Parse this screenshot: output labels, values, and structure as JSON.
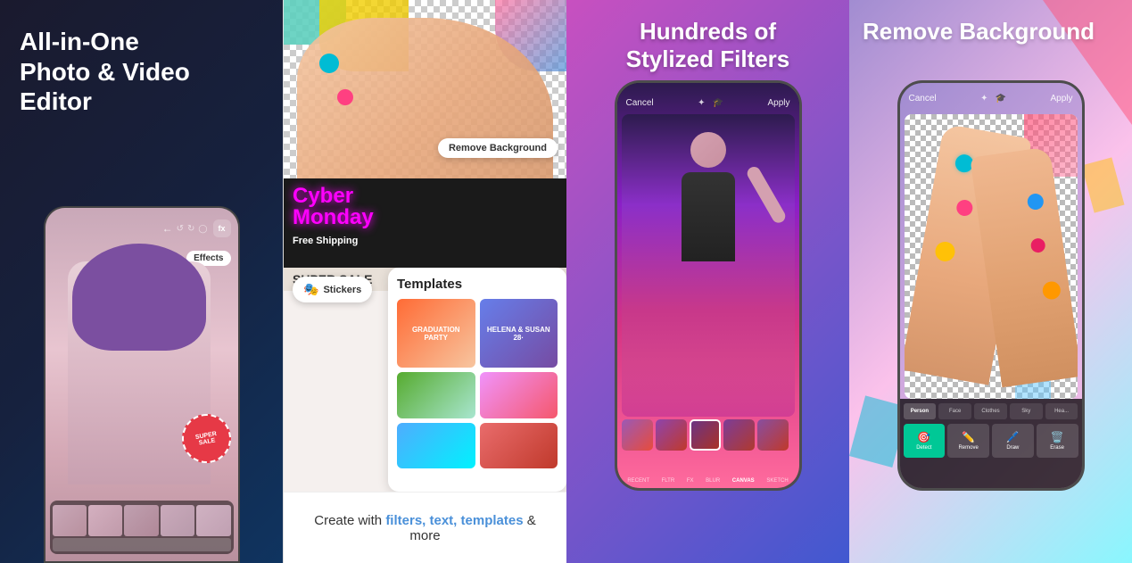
{
  "panels": [
    {
      "id": "panel-1",
      "title": "All-in-One\nPhoto & Video\nEditor",
      "effects_label": "Effects",
      "sale_text": "SUPER\nSALE"
    },
    {
      "id": "panel-2",
      "remove_bg_label": "Remove Background",
      "stickers_label": "Stickers",
      "templates_title": "Templates",
      "caption": "Create with filters, text, templates & more",
      "caption_highlight_words": [
        "filters,",
        "text,",
        "templates",
        "&",
        "more"
      ]
    },
    {
      "id": "panel-3",
      "title": "Hundreds of\nStylized Filters",
      "toolbar": {
        "cancel": "Cancel",
        "apply": "Apply"
      },
      "filter_tabs": [
        "RECENT",
        "FLTR",
        "FX",
        "BLUR",
        "CANVAS",
        "SKETCH"
      ]
    },
    {
      "id": "panel-4",
      "title": "Remove Background",
      "toolbar": {
        "cancel": "Cancel",
        "apply": "Apply"
      },
      "category_tabs": [
        "Person",
        "Face",
        "Clothes",
        "Sky",
        "Hea..."
      ],
      "action_tabs": [
        "Detect",
        "Remove",
        "Draw",
        "Erase"
      ]
    }
  ]
}
